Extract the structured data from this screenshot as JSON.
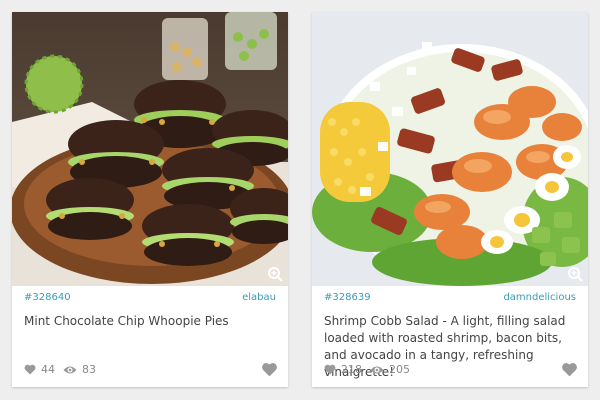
{
  "cards": [
    {
      "id": "#328640",
      "author": "elabau",
      "title": "Mint Chocolate Chip Whoopie Pies",
      "likes": "44",
      "views": "83"
    },
    {
      "id": "#328639",
      "author": "damndelicious",
      "title": "Shrimp Cobb Salad - A light, filling salad loaded with roasted shrimp, bacon bits, and avocado in a tangy, refreshing vinaigrette!",
      "likes": "218",
      "views": "205"
    }
  ],
  "colors": {
    "link": "#3a9bb6",
    "background": "#eeeeee",
    "card": "#ffffff",
    "muted": "#888888"
  },
  "icons": [
    "zoom-icon",
    "heart-icon",
    "eye-icon",
    "favorite-heart-icon"
  ]
}
